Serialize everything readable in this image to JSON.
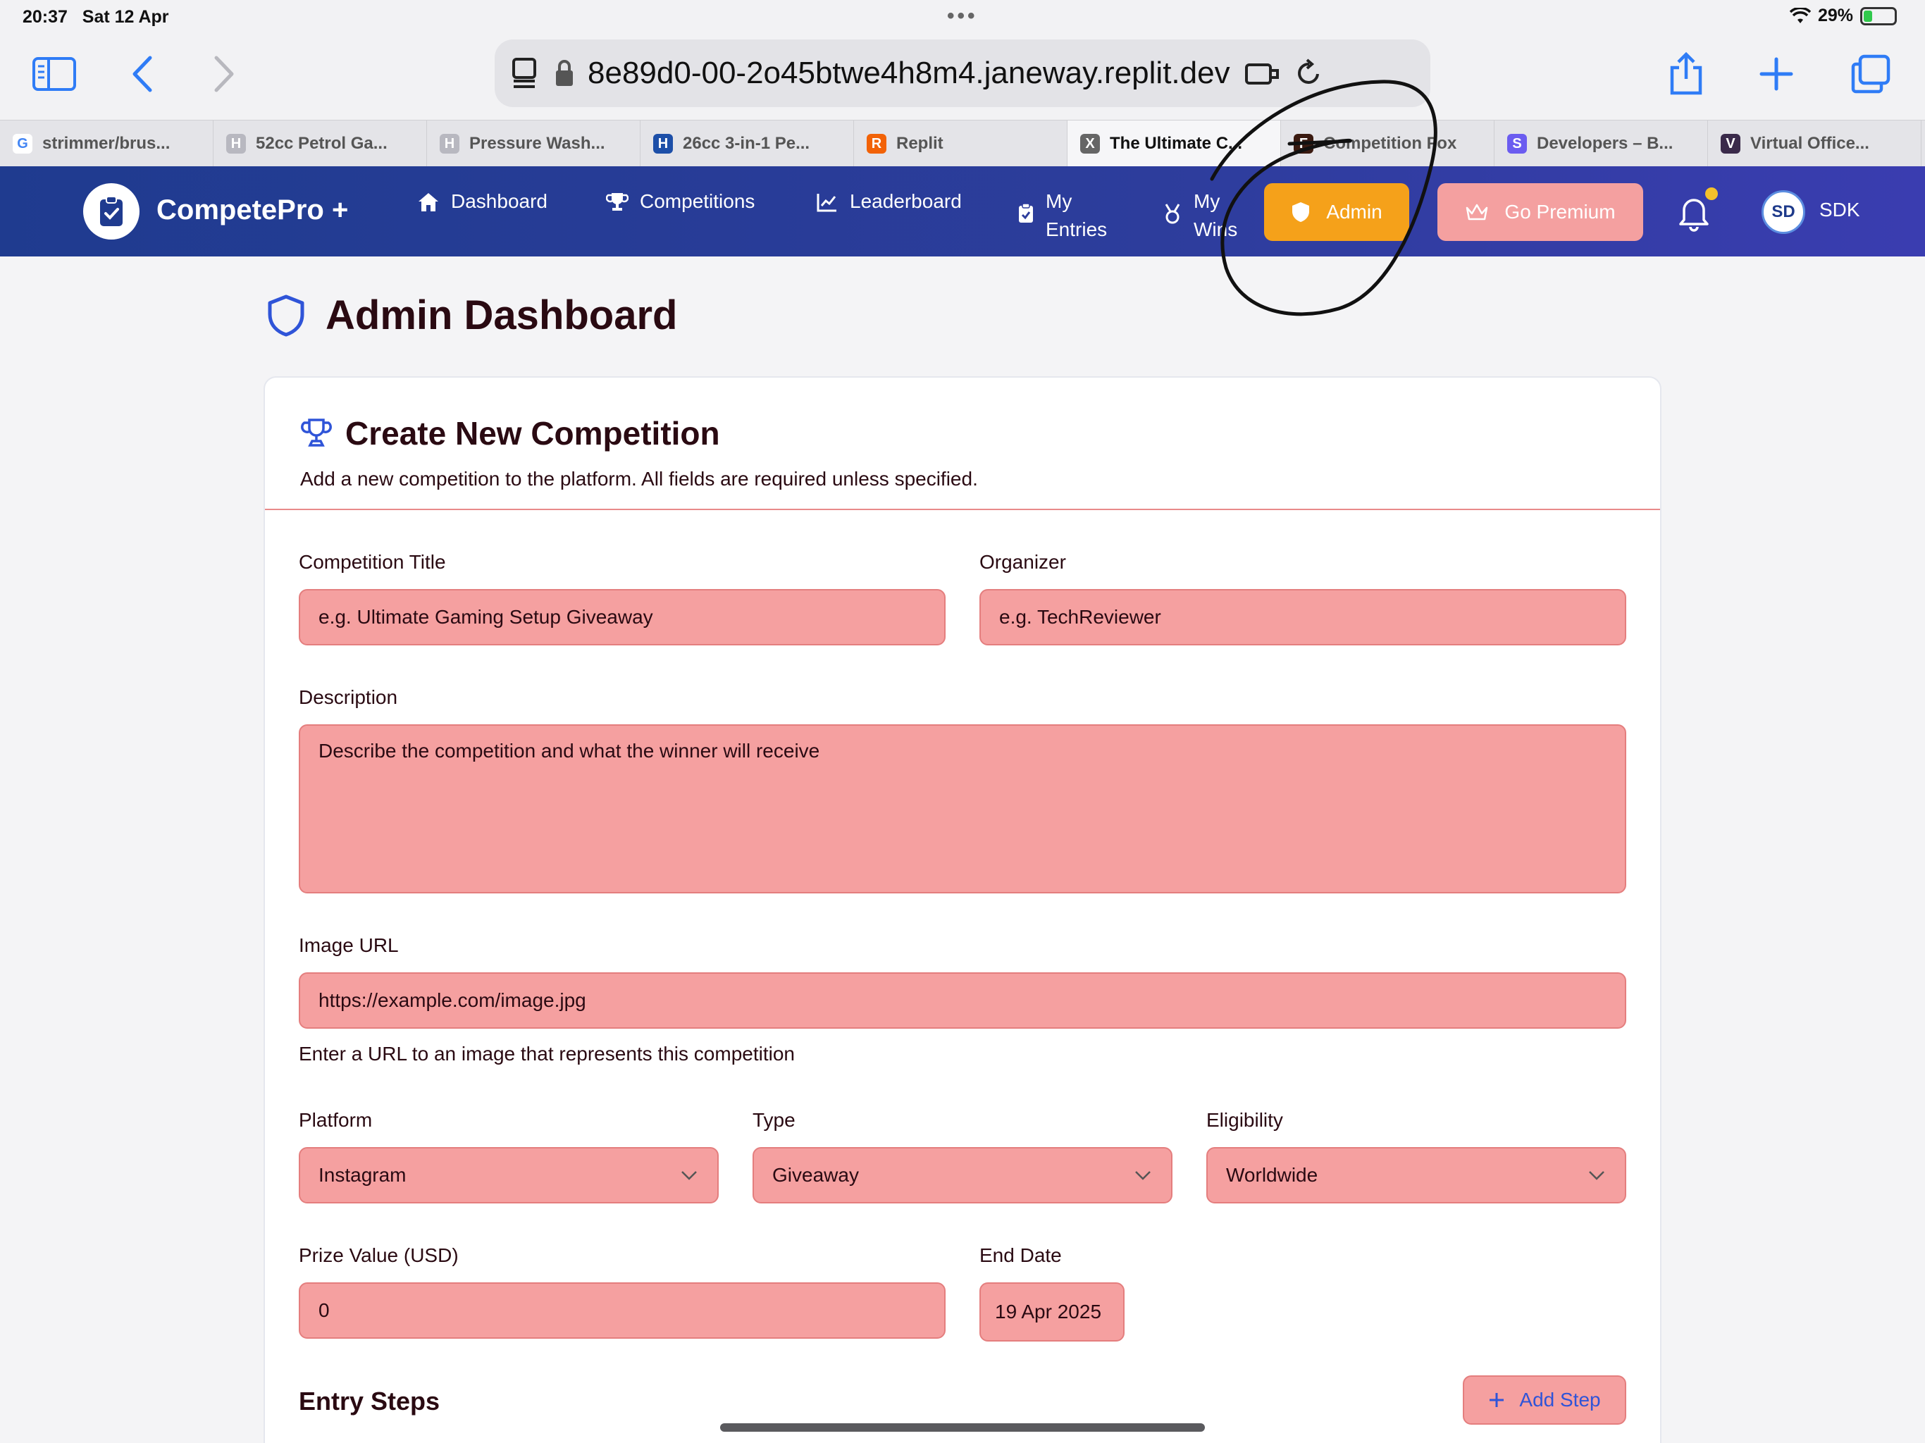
{
  "status": {
    "time": "20:37",
    "date": "Sat 12 Apr",
    "battery": "29%",
    "battery_level": 0.29
  },
  "browser": {
    "url": "8e89d0-00-2o45btwe4h8m4.janeway.replit.dev",
    "tabs": [
      {
        "label": "strimmer/brus...",
        "favicon": "G",
        "color": "#ffffff"
      },
      {
        "label": "52cc Petrol Ga...",
        "favicon": "H",
        "color": "#b8b8c0"
      },
      {
        "label": "Pressure Wash...",
        "favicon": "H",
        "color": "#b8b8c0"
      },
      {
        "label": "26cc 3-in-1 Pe...",
        "favicon": "H",
        "color": "#1d4fa8"
      },
      {
        "label": "Replit",
        "favicon": "R",
        "color": "#f26207"
      },
      {
        "label": "The Ultimate C...",
        "favicon": "X",
        "color": "#666666"
      },
      {
        "label": "Competition Fox",
        "favicon": "F",
        "color": "#3a1a10"
      },
      {
        "label": "Developers – B...",
        "favicon": "S",
        "color": "#6b5cf0"
      },
      {
        "label": "Virtual Office...",
        "favicon": "V",
        "color": "#3a2a4a"
      }
    ],
    "active_tab": 5
  },
  "app": {
    "name": "CompetePro",
    "name_suffix": "+",
    "nav": {
      "dashboard": "Dashboard",
      "competitions": "Competitions",
      "leaderboard": "Leaderboard",
      "my_entries_1": "My",
      "my_entries_2": "Entries",
      "my_wins_1": "My",
      "my_wins_2": "Wins"
    },
    "admin_label": "Admin",
    "premium_label": "Go Premium",
    "avatar_initials": "SD",
    "username": "SDK",
    "colors": {
      "nav": "#1f3b8f",
      "admin": "#f5a11a",
      "premium": "#f4a0a0",
      "field": "#f5a0a0"
    }
  },
  "page": {
    "title": "Admin Dashboard",
    "card": {
      "title": "Create New Competition",
      "subtitle": "Add a new competition to the platform. All fields are required unless specified."
    },
    "form": {
      "title_label": "Competition Title",
      "title_placeholder": "e.g. Ultimate Gaming Setup Giveaway",
      "organizer_label": "Organizer",
      "organizer_placeholder": "e.g. TechReviewer",
      "description_label": "Description",
      "description_placeholder": "Describe the competition and what the winner will receive",
      "image_label": "Image URL",
      "image_placeholder": "https://example.com/image.jpg",
      "image_help": "Enter a URL to an image that represents this competition",
      "platform_label": "Platform",
      "platform_value": "Instagram",
      "type_label": "Type",
      "type_value": "Giveaway",
      "eligibility_label": "Eligibility",
      "eligibility_value": "Worldwide",
      "prize_label": "Prize Value (USD)",
      "prize_value": "0",
      "enddate_label": "End Date",
      "enddate_value": "19 Apr 2025",
      "entry_steps_title": "Entry Steps",
      "add_step_label": "Add Step"
    }
  }
}
